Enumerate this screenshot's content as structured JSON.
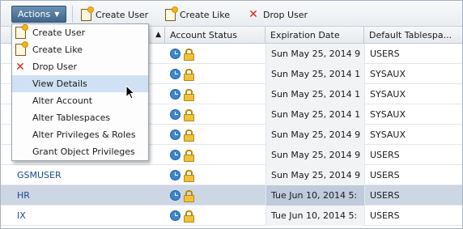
{
  "toolbar": {
    "actions_label": "Actions",
    "create_user_label": "Create User",
    "create_like_label": "Create Like",
    "drop_user_label": "Drop User"
  },
  "grid": {
    "columns": [
      "Account Status",
      "Expiration Date",
      "Default Tablespa..."
    ],
    "rows": [
      {
        "name": "",
        "expiration": "Sun May 25, 2014 9",
        "tablespace": "USERS"
      },
      {
        "name": "",
        "expiration": "Sun May 25, 2014 1",
        "tablespace": "SYSAUX"
      },
      {
        "name": "",
        "expiration": "Sun May 25, 2014 1",
        "tablespace": "SYSAUX"
      },
      {
        "name": "",
        "expiration": "Sun May 25, 2014 1",
        "tablespace": "SYSAUX"
      },
      {
        "name": "",
        "expiration": "Sun May 25, 2014 9",
        "tablespace": "SYSAUX"
      },
      {
        "name": "",
        "expiration": "Sun May 25, 2014 9",
        "tablespace": "USERS"
      },
      {
        "name": "GSMUSER",
        "expiration": "Sun May 25, 2014 9",
        "tablespace": "USERS"
      },
      {
        "name": "HR",
        "expiration": "Tue Jun 10, 2014 5:",
        "tablespace": "USERS"
      },
      {
        "name": "IX",
        "expiration": "Tue Jun 10, 2014 5:",
        "tablespace": "USERS"
      }
    ]
  },
  "menu": {
    "items": [
      {
        "label": "Create User",
        "icon": "create-user-icon"
      },
      {
        "label": "Create Like",
        "icon": "create-like-icon"
      },
      {
        "label": "Drop User",
        "icon": "drop-user-icon"
      },
      {
        "label": "View Details",
        "icon": ""
      },
      {
        "label": "Alter Account",
        "icon": ""
      },
      {
        "label": "Alter Tablespaces",
        "icon": ""
      },
      {
        "label": "Alter Privileges & Roles",
        "icon": ""
      },
      {
        "label": "Grant Object Privileges",
        "icon": ""
      }
    ],
    "highlighted": "View Details"
  },
  "colors": {
    "actions_button": "#4a7099",
    "link_text": "#1c4a8c",
    "selected_row": "#cdd6e3",
    "menu_hover": "#cfe1f3",
    "drop_x": "#d8261c"
  }
}
